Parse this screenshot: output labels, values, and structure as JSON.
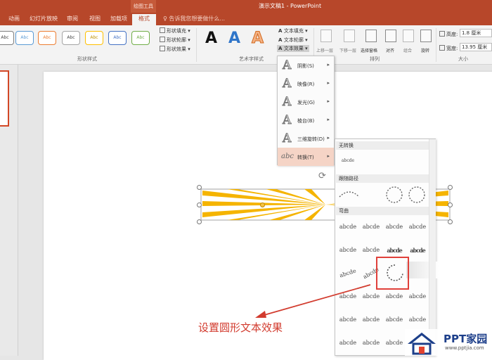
{
  "titlebar": {
    "context_tab_group": "绘图工具",
    "document_title": "演示文稿1 - PowerPoint",
    "tell_me": "告诉我您想要做什么..."
  },
  "tabs": [
    "动画",
    "幻灯片放映",
    "审阅",
    "视图",
    "加载项",
    "格式"
  ],
  "active_tab": "格式",
  "ribbon": {
    "shape_style_thumb_label": "Abc",
    "shape_style_items": [
      "形状填充",
      "形状轮廓",
      "形状效果"
    ],
    "shape_styles_group": "形状样式",
    "wordart_glyphs": [
      "A",
      "A",
      "A"
    ],
    "wordart_items": [
      "文本填充",
      "文本轮廓",
      "文本效果"
    ],
    "wordart_group": "艺术字样式",
    "arrange_items": [
      "上移一层",
      "下移一层",
      "选择窗格",
      "对齐",
      "组合",
      "旋转"
    ],
    "arrange_group": "排列",
    "size_height_label": "高度:",
    "size_height_value": "1.8 厘米",
    "size_width_label": "宽度:",
    "size_width_value": "13.95 厘米",
    "size_group": "大小"
  },
  "effects_menu": [
    {
      "label": "阴影(S)",
      "glyph": "A",
      "submenu": true
    },
    {
      "label": "映像(R)",
      "glyph": "A",
      "submenu": true
    },
    {
      "label": "发光(G)",
      "glyph": "A",
      "submenu": true
    },
    {
      "label": "棱台(B)",
      "glyph": "A",
      "submenu": true
    },
    {
      "label": "三维旋转(D)",
      "glyph": "A",
      "submenu": true
    },
    {
      "label": "转换(T)",
      "glyph": "abc",
      "submenu": true,
      "active": true
    }
  ],
  "transform_gallery": {
    "no_transform_header": "无转换",
    "no_transform_sample": "abcde",
    "follow_path_header": "跟随路径",
    "warp_header": "弯曲",
    "sample_text": "abcde"
  },
  "annotation": "设置圆形文本效果",
  "watermark": {
    "brand": "PPT家园",
    "url": "www.pptjia.com"
  },
  "colors": {
    "accent": "#b7472a",
    "highlight": "#f5d4c6",
    "callout": "#d23b2e",
    "sunburst": "#f5b400"
  }
}
